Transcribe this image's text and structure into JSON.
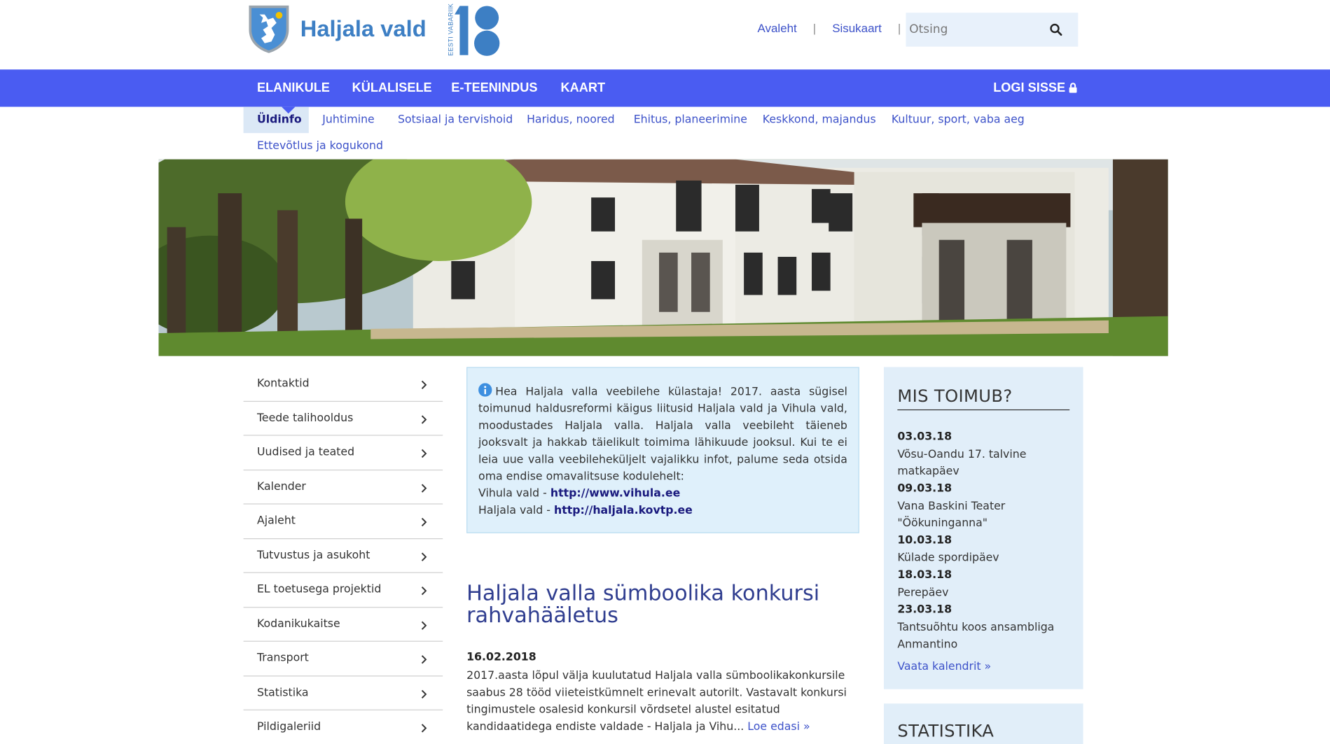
{
  "header": {
    "site_name": "Haljala vald",
    "ev100_text": "EESTI VABARIIK",
    "top_links": [
      "Avaleht",
      "Sisukaart"
    ],
    "search_placeholder": "Otsing"
  },
  "mainnav": {
    "items": [
      "ELANIKULE",
      "KÜLALISELE",
      "E-TEENINDUS",
      "KAART"
    ],
    "login_label": "LOGI SISSE"
  },
  "subnav": {
    "items": [
      "Üldinfo",
      "Juhtimine",
      "Sotsiaal ja tervishoid",
      "Haridus, noored",
      "Ehitus, planeerimine",
      "Keskkond, majandus",
      "Kultuur, sport, vaba aeg",
      "Ettevõtlus ja kogukond"
    ]
  },
  "sidebar": {
    "items": [
      "Kontaktid",
      "Teede talihooldus",
      "Uudised ja teated",
      "Kalender",
      "Ajaleht",
      "Tutvustus ja asukoht",
      "EL toetusega projektid",
      "Kodanikukaitse",
      "Transport",
      "Statistika",
      "Pildigaleriid"
    ]
  },
  "infobox": {
    "text": "Hea Haljala valla veebilehe külastaja! 2017. aasta sügisel toimunud haldusreformi käigus liitusid Haljala vald ja Vihula vald, moodustades Haljala valla. Haljala valla veebileht täieneb jooksvalt ja hakkab täielikult toimima lähikuude jooksul. Kui te ei leia uue valla veebileheküljelt vajalikku infot, palume seda otsida oma endise omavalitsuse kodulehelt:",
    "link1_label": "Vihula vald - ",
    "link1_url": "http://www.vihula.ee",
    "link2_label": "Haljala vald - ",
    "link2_url": "http://haljala.kovtp.ee"
  },
  "article": {
    "title": "Haljala valla sümboolika konkursi rahvahääletus",
    "date": "16.02.2018",
    "body": "2017.aasta lõpul välja kuulutatud Haljala valla sümboolikakonkursile saabus 28 tööd viieteistkümnelt erinevalt autorilt. Vastavalt konkursi tingimustele osalesid konkursil võrdsetel alustel esitatud kandidaatidega endiste valdade - Haljala ja Vihu...",
    "read_more": "Loe edasi »"
  },
  "events_box": {
    "heading": "MIS TOIMUB?",
    "events": [
      {
        "date": "03.03.18",
        "title": "Võsu-Oandu 17. talvine matkapäev"
      },
      {
        "date": "09.03.18",
        "title": "Vana Baskini Teater \"Öökuninganna\""
      },
      {
        "date": "10.03.18",
        "title": "Külade spordipäev"
      },
      {
        "date": "18.03.18",
        "title": "Perepäev"
      },
      {
        "date": "23.03.18",
        "title": "Tantsuõhtu koos ansambliga Anmantino"
      }
    ],
    "calendar_link": "Vaata kalendrit »"
  },
  "stats_box": {
    "heading": "STATISTIKA"
  },
  "colors": {
    "nav_blue": "#4a5cf2",
    "link_blue": "#3d52c9",
    "logo_blue": "#3d7fc4",
    "info_bg": "#dff0fb",
    "side_box_bg": "#e1eef9"
  },
  "icons": [
    "crest-icon",
    "ev100-logo",
    "search-icon",
    "lock-icon",
    "chevron-right-icon",
    "info-icon"
  ]
}
